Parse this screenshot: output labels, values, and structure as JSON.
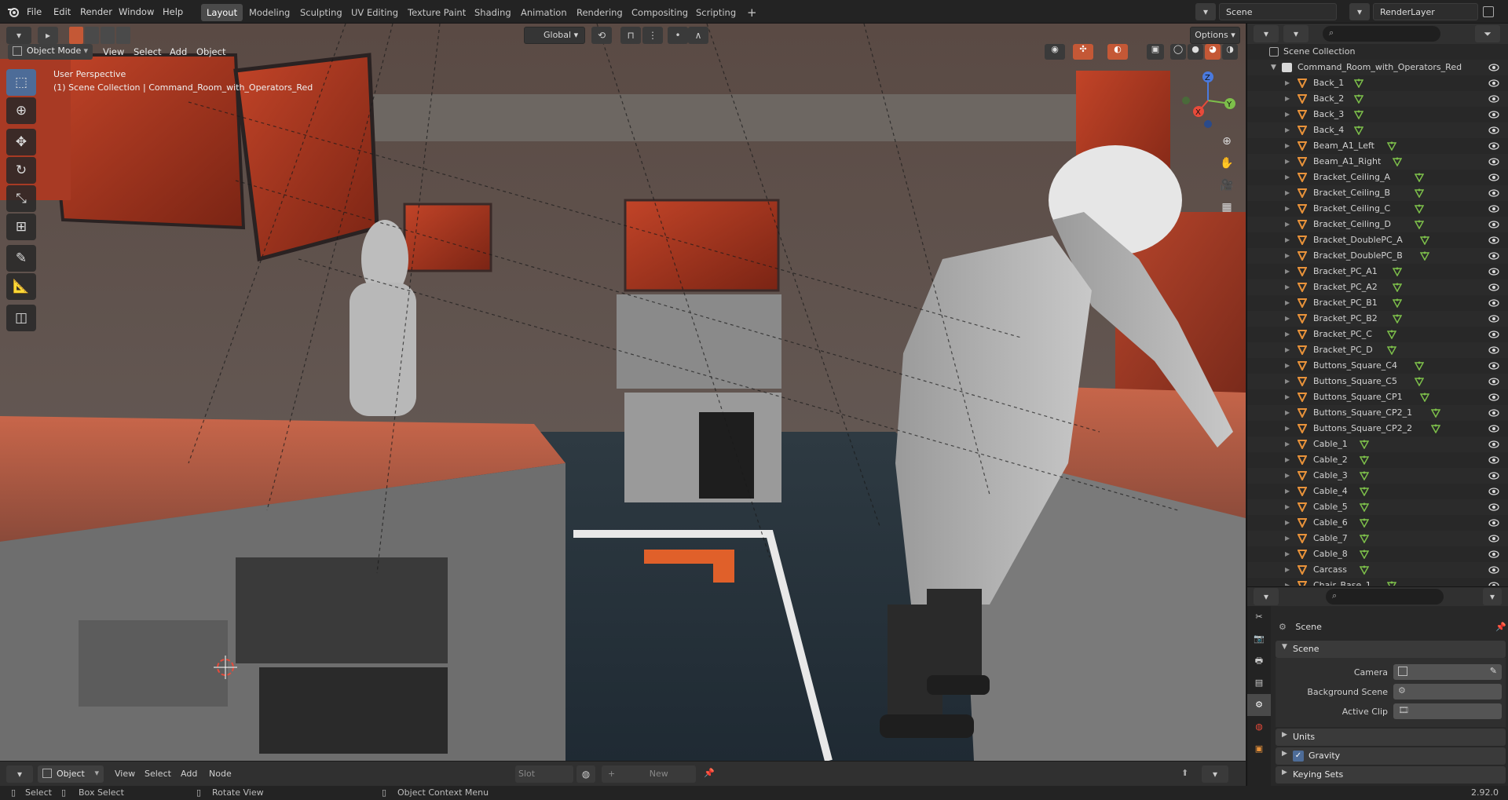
{
  "topbar": {
    "menus": [
      "File",
      "Edit",
      "Render",
      "Window",
      "Help"
    ],
    "workspaces": [
      "Layout",
      "Modeling",
      "Sculpting",
      "UV Editing",
      "Texture Paint",
      "Shading",
      "Animation",
      "Rendering",
      "Compositing",
      "Scripting"
    ],
    "active_workspace": "Layout",
    "add_tab_label": "+",
    "scene_name": "Scene",
    "view_layer_name": "RenderLayer"
  },
  "viewport_header": {
    "mode_label": "Object Mode",
    "menus": [
      "View",
      "Select",
      "Add",
      "Object"
    ],
    "transform_orientation": "Global",
    "options_label": "Options"
  },
  "viewport_overlay": {
    "perspective_label": "User Perspective",
    "collection_path": "(1) Scene Collection | Command_Room_with_Operators_Red",
    "axis_labels": [
      "X",
      "Y",
      "Z"
    ]
  },
  "outliner": {
    "root_label": "Scene Collection",
    "collection_label": "Command_Room_with_Operators_Red",
    "items": [
      "Back_1",
      "Back_2",
      "Back_3",
      "Back_4",
      "Beam_A1_Left",
      "Beam_A1_Right",
      "Bracket_Ceiling_A",
      "Bracket_Ceiling_B",
      "Bracket_Ceiling_C",
      "Bracket_Ceiling_D",
      "Bracket_DoublePC_A",
      "Bracket_DoublePC_B",
      "Bracket_PC_A1",
      "Bracket_PC_A2",
      "Bracket_PC_B1",
      "Bracket_PC_B2",
      "Bracket_PC_C",
      "Bracket_PC_D",
      "Buttons_Square_C4",
      "Buttons_Square_C5",
      "Buttons_Square_CP1",
      "Buttons_Square_CP2_1",
      "Buttons_Square_CP2_2",
      "Cable_1",
      "Cable_2",
      "Cable_3",
      "Cable_4",
      "Cable_5",
      "Cable_6",
      "Cable_7",
      "Cable_8",
      "Carcass",
      "Chair_Base_1"
    ]
  },
  "properties": {
    "context_label": "Scene",
    "panel_label": "Scene",
    "camera_label": "Camera",
    "background_scene_label": "Background Scene",
    "active_clip_label": "Active Clip",
    "units_label": "Units",
    "gravity_label": "Gravity",
    "gravity_checked": true,
    "keying_sets_label": "Keying Sets"
  },
  "bottom_editor": {
    "mode_label": "Object",
    "menus": [
      "View",
      "Select",
      "Add",
      "Node"
    ],
    "slot_label": "Slot",
    "new_label": "New"
  },
  "statusbar": {
    "select_label": "Select",
    "box_select_label": "Box Select",
    "rotate_view_label": "Rotate View",
    "context_menu_label": "Object Context Menu",
    "version": "2.92.0"
  },
  "colors": {
    "accent_blue": "#4d6c98",
    "object_orange": "#e8923a",
    "mesh_green": "#7dbf4a",
    "panel_bg": "#282828"
  }
}
